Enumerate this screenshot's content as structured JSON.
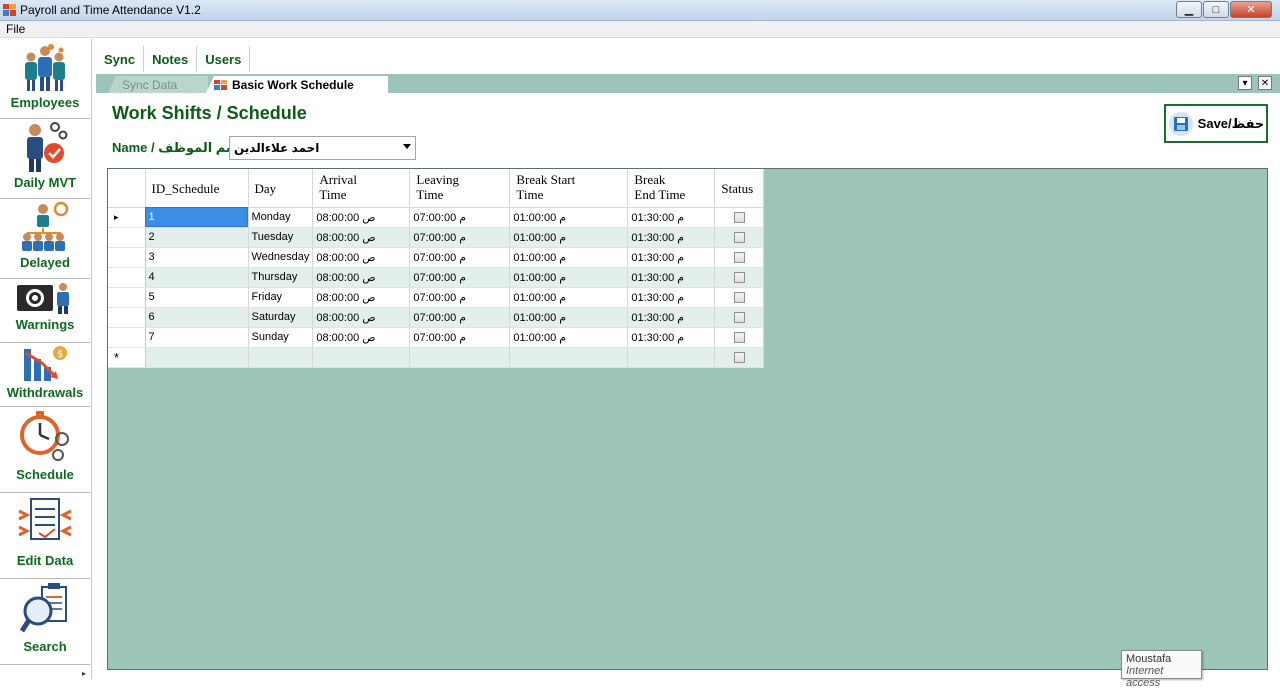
{
  "window": {
    "title": "Payroll and Time Attendance V1.2",
    "min": "▁",
    "max": "□",
    "close": "✕"
  },
  "menu": {
    "file": "File"
  },
  "sidebar": {
    "items": [
      {
        "label": "Employees",
        "icon": "employees-group-icon"
      },
      {
        "label": "Daily MVT",
        "icon": "daily-movement-icon"
      },
      {
        "label": "Delayed",
        "icon": "delayed-team-icon"
      },
      {
        "label": "Warnings",
        "icon": "warnings-camera-icon"
      },
      {
        "label": "Withdrawals",
        "icon": "withdrawals-chart-icon"
      },
      {
        "label": "Schedule",
        "icon": "schedule-clock-icon"
      },
      {
        "label": "Edit Data",
        "icon": "edit-document-icon"
      },
      {
        "label": "Search",
        "icon": "search-clipboard-icon"
      }
    ]
  },
  "toptabs": [
    "Sync",
    "Notes",
    "Users"
  ],
  "doctabs": {
    "inactive": "Sync Data",
    "active": "Basic Work Schedule Time"
  },
  "tabctl": {
    "dropdown": "▾",
    "close": "✕"
  },
  "page": {
    "title": "Work  Shifts / Schedule",
    "name_label": "Name / إسم الموظف",
    "employee_selected": "احمد علاءالدين",
    "save_label": "Save/حفظ"
  },
  "grid": {
    "columns": [
      "ID_Schedule",
      "Day",
      "Arrival\nTime",
      "Leaving\nTime",
      "Break Start\nTime",
      "Break\nEnd Time",
      "Status"
    ],
    "current_row_marker": "▸",
    "new_row_marker": "*",
    "rows": [
      {
        "id": "1",
        "day": "Monday",
        "arrival": "08:00:00 ص",
        "leaving": "07:00:00 م",
        "break_start": "01:00:00 م",
        "break_end": "01:30:00 م",
        "status": false
      },
      {
        "id": "2",
        "day": "Tuesday",
        "arrival": "08:00:00 ص",
        "leaving": "07:00:00 م",
        "break_start": "01:00:00 م",
        "break_end": "01:30:00 م",
        "status": false
      },
      {
        "id": "3",
        "day": "Wednesday",
        "arrival": "08:00:00 ص",
        "leaving": "07:00:00 م",
        "break_start": "01:00:00 م",
        "break_end": "01:30:00 م",
        "status": false
      },
      {
        "id": "4",
        "day": "Thursday",
        "arrival": "08:00:00 ص",
        "leaving": "07:00:00 م",
        "break_start": "01:00:00 م",
        "break_end": "01:30:00 م",
        "status": false
      },
      {
        "id": "5",
        "day": "Friday",
        "arrival": "08:00:00 ص",
        "leaving": "07:00:00 م",
        "break_start": "01:00:00 م",
        "break_end": "01:30:00 م",
        "status": false
      },
      {
        "id": "6",
        "day": "Saturday",
        "arrival": "08:00:00 ص",
        "leaving": "07:00:00 م",
        "break_start": "01:00:00 م",
        "break_end": "01:30:00 م",
        "status": false
      },
      {
        "id": "7",
        "day": "Sunday",
        "arrival": "08:00:00 ص",
        "leaving": "07:00:00 م",
        "break_start": "01:00:00 م",
        "break_end": "01:30:00 م",
        "status": false
      }
    ]
  },
  "tooltip": {
    "user": "Moustafa",
    "status": "Internet access"
  },
  "colors": {
    "brand_green": "#0b5c14",
    "grid_bg": "#9dc4b8",
    "alt_row": "#e3efeb",
    "selection": "#3a8ee6"
  }
}
